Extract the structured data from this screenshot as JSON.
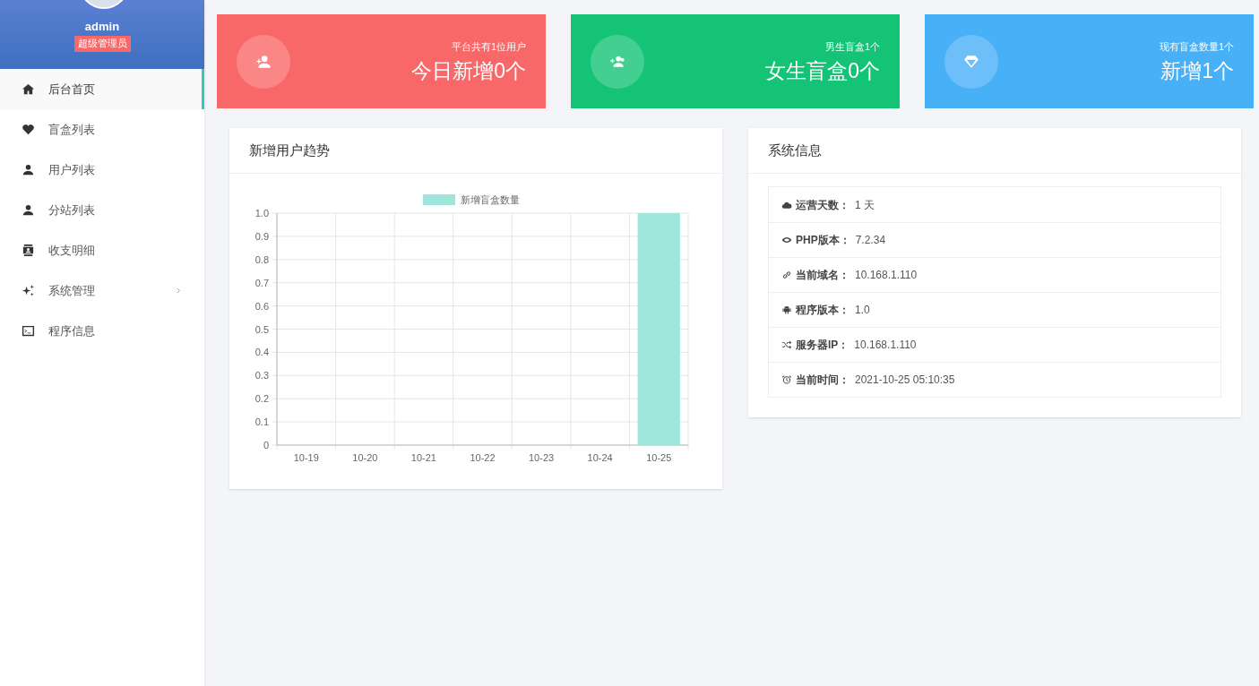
{
  "user": {
    "name": "admin",
    "role": "超级管理员"
  },
  "sidebar": {
    "items": [
      {
        "label": "后台首页",
        "selected": true,
        "has_submenu": false
      },
      {
        "label": "盲盒列表",
        "selected": false,
        "has_submenu": false
      },
      {
        "label": "用户列表",
        "selected": false,
        "has_submenu": false
      },
      {
        "label": "分站列表",
        "selected": false,
        "has_submenu": false
      },
      {
        "label": "收支明细",
        "selected": false,
        "has_submenu": false
      },
      {
        "label": "系统管理",
        "selected": false,
        "has_submenu": true
      },
      {
        "label": "程序信息",
        "selected": false,
        "has_submenu": false
      }
    ]
  },
  "stats": [
    {
      "subtitle": "平台共有1位用户",
      "value": "今日新增0个",
      "color": "#f96868"
    },
    {
      "subtitle": "男生盲盒1个",
      "value": "女生盲盒0个",
      "color": "#15c377"
    },
    {
      "subtitle": "现有盲盒数量1个",
      "value": "新增1个",
      "color": "#48b0f7"
    }
  ],
  "trend_panel": {
    "title": "新增用户趋势",
    "chart_data": {
      "type": "bar",
      "grid": true,
      "categories": [
        "10-19",
        "10-20",
        "10-21",
        "10-22",
        "10-23",
        "10-24",
        "10-25"
      ],
      "series": [
        {
          "name": "新增盲盒数量",
          "color": "#9ee5dc",
          "values": [
            0,
            0,
            0,
            0,
            0,
            0,
            1
          ]
        }
      ],
      "ylim": [
        0,
        1
      ],
      "yticks": [
        0,
        0.1,
        0.2,
        0.3,
        0.4,
        0.5,
        0.6,
        0.7,
        0.8,
        0.9,
        {
          "value": 1,
          "label": "1.0"
        }
      ]
    }
  },
  "system_panel": {
    "title": "系统信息",
    "rows": [
      {
        "label": "运营天数：",
        "value": "1 天"
      },
      {
        "label": "PHP版本：",
        "value": "7.2.34"
      },
      {
        "label": "当前域名：",
        "value": "10.168.1.110"
      },
      {
        "label": "程序版本：",
        "value": "1.0"
      },
      {
        "label": "服务器IP：",
        "value": "10.168.1.110"
      },
      {
        "label": "当前时间：",
        "value": "2021-10-25 05:10:35"
      }
    ]
  }
}
